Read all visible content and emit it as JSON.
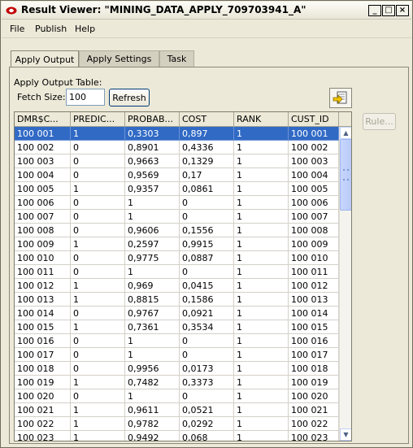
{
  "window": {
    "title": "Result Viewer: \"MINING_DATA_APPLY_709703941_A\"",
    "app_icon": "oracle-data-miner-icon",
    "controls": [
      "_",
      "□",
      "×"
    ]
  },
  "menu": [
    {
      "label": "File"
    },
    {
      "label": "Publish"
    },
    {
      "label": "Help"
    }
  ],
  "tabs": [
    {
      "label": "Apply Output",
      "active": true
    },
    {
      "label": "Apply Settings",
      "active": false
    },
    {
      "label": "Task",
      "active": false
    }
  ],
  "panel": {
    "table_label": "Apply Output Table:",
    "fetch_label": "Fetch Size:",
    "fetch_value": "100",
    "refresh_label": "Refresh",
    "rule_label": "Rule...",
    "export_icon": "export-icon"
  },
  "table": {
    "columns": [
      "DMR$C...",
      "PREDIC...",
      "PROBAB...",
      "COST",
      "RANK",
      "CUST_ID"
    ],
    "selected_row": 0,
    "rows": [
      [
        "100 001",
        "1",
        "0,3303",
        "0,897",
        "1",
        "100 001"
      ],
      [
        "100 002",
        "0",
        "0,8901",
        "0,4336",
        "1",
        "100 002"
      ],
      [
        "100 003",
        "0",
        "0,9663",
        "0,1329",
        "1",
        "100 003"
      ],
      [
        "100 004",
        "0",
        "0,9569",
        "0,17",
        "1",
        "100 004"
      ],
      [
        "100 005",
        "1",
        "0,9357",
        "0,0861",
        "1",
        "100 005"
      ],
      [
        "100 006",
        "0",
        "1",
        "0",
        "1",
        "100 006"
      ],
      [
        "100 007",
        "0",
        "1",
        "0",
        "1",
        "100 007"
      ],
      [
        "100 008",
        "0",
        "0,9606",
        "0,1556",
        "1",
        "100 008"
      ],
      [
        "100 009",
        "1",
        "0,2597",
        "0,9915",
        "1",
        "100 009"
      ],
      [
        "100 010",
        "0",
        "0,9775",
        "0,0887",
        "1",
        "100 010"
      ],
      [
        "100 011",
        "0",
        "1",
        "0",
        "1",
        "100 011"
      ],
      [
        "100 012",
        "1",
        "0,969",
        "0,0415",
        "1",
        "100 012"
      ],
      [
        "100 013",
        "1",
        "0,8815",
        "0,1586",
        "1",
        "100 013"
      ],
      [
        "100 014",
        "0",
        "0,9767",
        "0,0921",
        "1",
        "100 014"
      ],
      [
        "100 015",
        "1",
        "0,7361",
        "0,3534",
        "1",
        "100 015"
      ],
      [
        "100 016",
        "0",
        "1",
        "0",
        "1",
        "100 016"
      ],
      [
        "100 017",
        "0",
        "1",
        "0",
        "1",
        "100 017"
      ],
      [
        "100 018",
        "0",
        "0,9956",
        "0,0173",
        "1",
        "100 018"
      ],
      [
        "100 019",
        "1",
        "0,7482",
        "0,3373",
        "1",
        "100 019"
      ],
      [
        "100 020",
        "0",
        "1",
        "0",
        "1",
        "100 020"
      ],
      [
        "100 021",
        "1",
        "0,9611",
        "0,0521",
        "1",
        "100 021"
      ],
      [
        "100 022",
        "1",
        "0,9782",
        "0,0292",
        "1",
        "100 022"
      ],
      [
        "100 023",
        "1",
        "0,9492",
        "0,068",
        "1",
        "100 023"
      ]
    ]
  }
}
